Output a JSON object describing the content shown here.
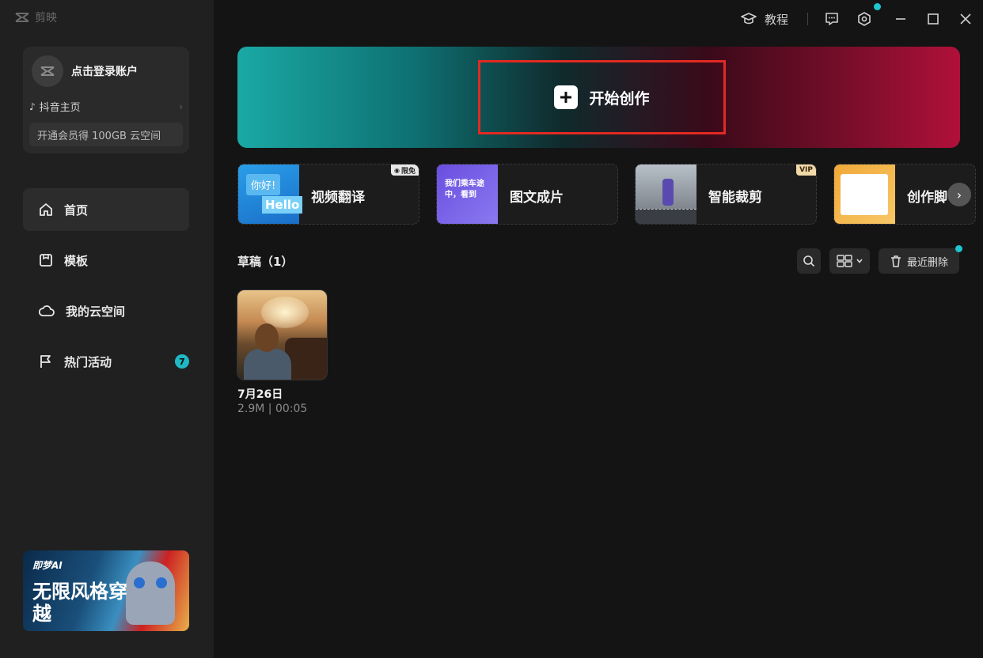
{
  "app": {
    "name": "剪映"
  },
  "account": {
    "login_label": "点击登录账户",
    "douyin_label": "抖音主页",
    "vip_offer": "开通会员得 100GB 云空间"
  },
  "nav": {
    "items": [
      {
        "label": "首页",
        "icon": "home-icon",
        "active": true
      },
      {
        "label": "模板",
        "icon": "template-icon",
        "active": false
      },
      {
        "label": "我的云空间",
        "icon": "cloud-icon",
        "active": false
      },
      {
        "label": "热门活动",
        "icon": "flag-icon",
        "active": false
      }
    ],
    "activity_badge": "7"
  },
  "promo": {
    "brand": "即梦AI",
    "title": "无限风格穿越"
  },
  "topbar": {
    "tutorial_label": "教程"
  },
  "banner": {
    "create_label": "开始创作"
  },
  "features": [
    {
      "label": "视频翻译",
      "thumb_text_top": "你好!",
      "thumb_text_bottom": "Hello",
      "tag": "限免"
    },
    {
      "label": "图文成片",
      "thumb_text": "我们乘车途中，看到"
    },
    {
      "label": "智能裁剪",
      "tag": "VIP"
    },
    {
      "label": "创作脚"
    }
  ],
  "drafts": {
    "title": "草稿（1）",
    "recently_deleted": "最近删除",
    "items": [
      {
        "date": "7月26日",
        "meta": "2.9M | 00:05"
      }
    ]
  },
  "colors": {
    "accent_teal": "#1fc6d0",
    "highlight_red": "#e02a22",
    "sidebar_bg": "#202020",
    "main_bg": "#141414"
  }
}
